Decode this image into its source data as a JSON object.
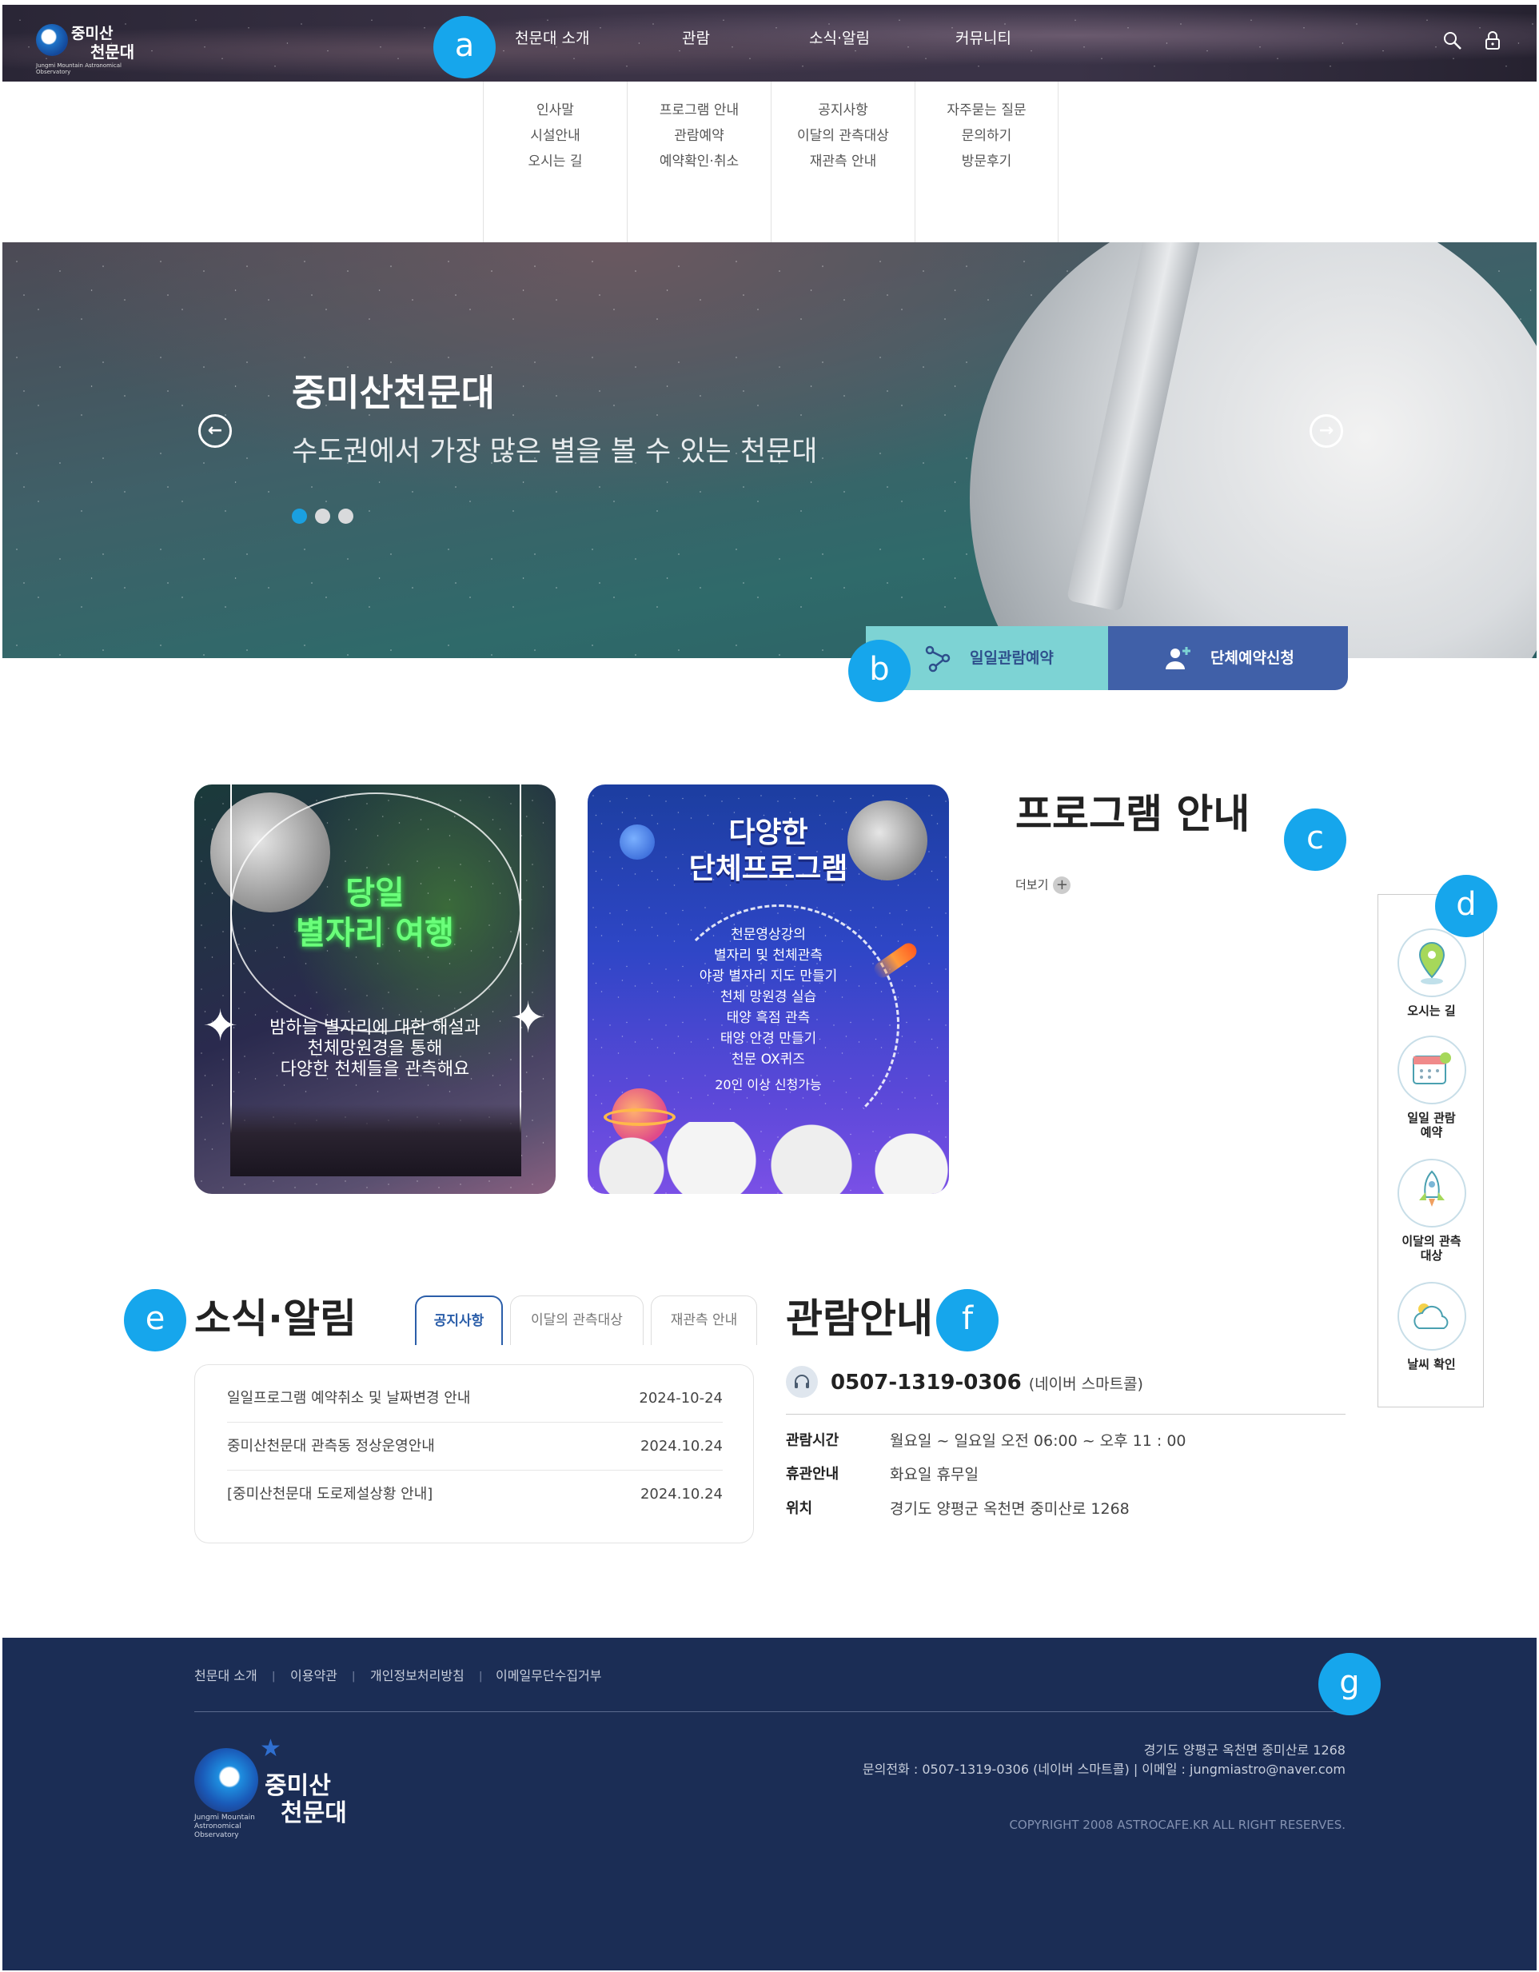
{
  "badges": {
    "a": "a",
    "b": "b",
    "c": "c",
    "d": "d",
    "e": "e",
    "f": "f",
    "g": "g"
  },
  "header": {
    "logo_line1": "중미산",
    "logo_line2": "천문대",
    "logo_en": "Jungmi Mountain Astronomical Observatory",
    "nav": [
      "천문대 소개",
      "관람",
      "소식·알림",
      "커뮤니티"
    ],
    "search_icon": "search-icon",
    "login_icon": "lock-icon"
  },
  "submenu": [
    [
      "인사말",
      "시설안내",
      "오시는 길"
    ],
    [
      "프로그램 안내",
      "관람예약",
      "예약확인·취소"
    ],
    [
      "공지사항",
      "이달의 관측대상",
      "재관측 안내"
    ],
    [
      "자주묻는 질문",
      "문의하기",
      "방문후기"
    ]
  ],
  "hero": {
    "title": "중미산천문대",
    "subtitle": "수도권에서 가장 많은 별을 볼 수 있는 천문대",
    "slide_count": 3,
    "active_slide": 1,
    "prev": "←",
    "next": "→"
  },
  "reserve": {
    "daily": "일일관람예약",
    "group": "단체예약신청",
    "daily_color": "#7dd3d4",
    "group_color": "#4060a8"
  },
  "programs": {
    "title": "프로그램 안내",
    "more": "더보기",
    "card1": {
      "title_line1": "당일",
      "title_line2": "별자리 여행",
      "text": [
        "밤하늘 별자리에 대한 해설과",
        "천체망원경을 통해",
        "다양한 천체들을 관측해요"
      ]
    },
    "card2": {
      "title_line1": "다양한",
      "title_line2": "단체프로그램",
      "text": [
        "천문영상강의",
        "별자리 및 천체관측",
        "야광 별자리 지도 만들기",
        "천체 망원경 실습",
        "태양 흑점 관측",
        "태양 안경 만들기",
        "천문 OX퀴즈"
      ],
      "note": "20인 이상 신청가능"
    }
  },
  "quick": [
    {
      "label": "오시는 길",
      "icon": "map-pin-icon"
    },
    {
      "label": "일일 관람 예약",
      "icon": "calendar-icon"
    },
    {
      "label": "이달의 관측 대상",
      "icon": "rocket-icon"
    },
    {
      "label": "날씨 확인",
      "icon": "weather-icon"
    }
  ],
  "news": {
    "title": "소식·알림",
    "tabs": [
      "공지사항",
      "이달의 관측대상",
      "재관측 안내"
    ],
    "active_tab": 0,
    "items": [
      {
        "title": "일일프로그램 예약취소 및 날짜변경 안내",
        "date": "2024-10-24"
      },
      {
        "title": "중미산천문대 관측동 정상운영안내",
        "date": "2024.10.24"
      },
      {
        "title": "[중미산천문대 도로제설상황 안내]",
        "date": "2024.10.24"
      }
    ]
  },
  "info": {
    "title": "관람안내",
    "phone": "0507-1319-0306",
    "phone_note": "(네이버 스마트콜)",
    "rows": [
      {
        "k": "관람시간",
        "v": "월요일 ~ 일요일  오전 06:00 ~ 오후 11 : 00"
      },
      {
        "k": "휴관안내",
        "v": "화요일 휴무일"
      },
      {
        "k": "위치",
        "v": "경기도 양평군 옥천면 중미산로 1268"
      }
    ]
  },
  "footer": {
    "links": [
      "천문대 소개",
      "이용약관",
      "개인정보처리방침",
      "이메일무단수집거부"
    ],
    "sep": "|",
    "logo_line1": "중미산",
    "logo_line2": "천문대",
    "logo_en": "Jungmi Mountain Astronomical Observatory",
    "address": "경기도 양평군 옥천면 중미산로 1268",
    "contact": "문의전화 : 0507-1319-0306 (네이버 스마트콜) | 이메일 : jungmiastro@naver.com",
    "copyright": "COPYRIGHT 2008 ASTROCAFE.KR ALL RIGHT RESERVES."
  }
}
